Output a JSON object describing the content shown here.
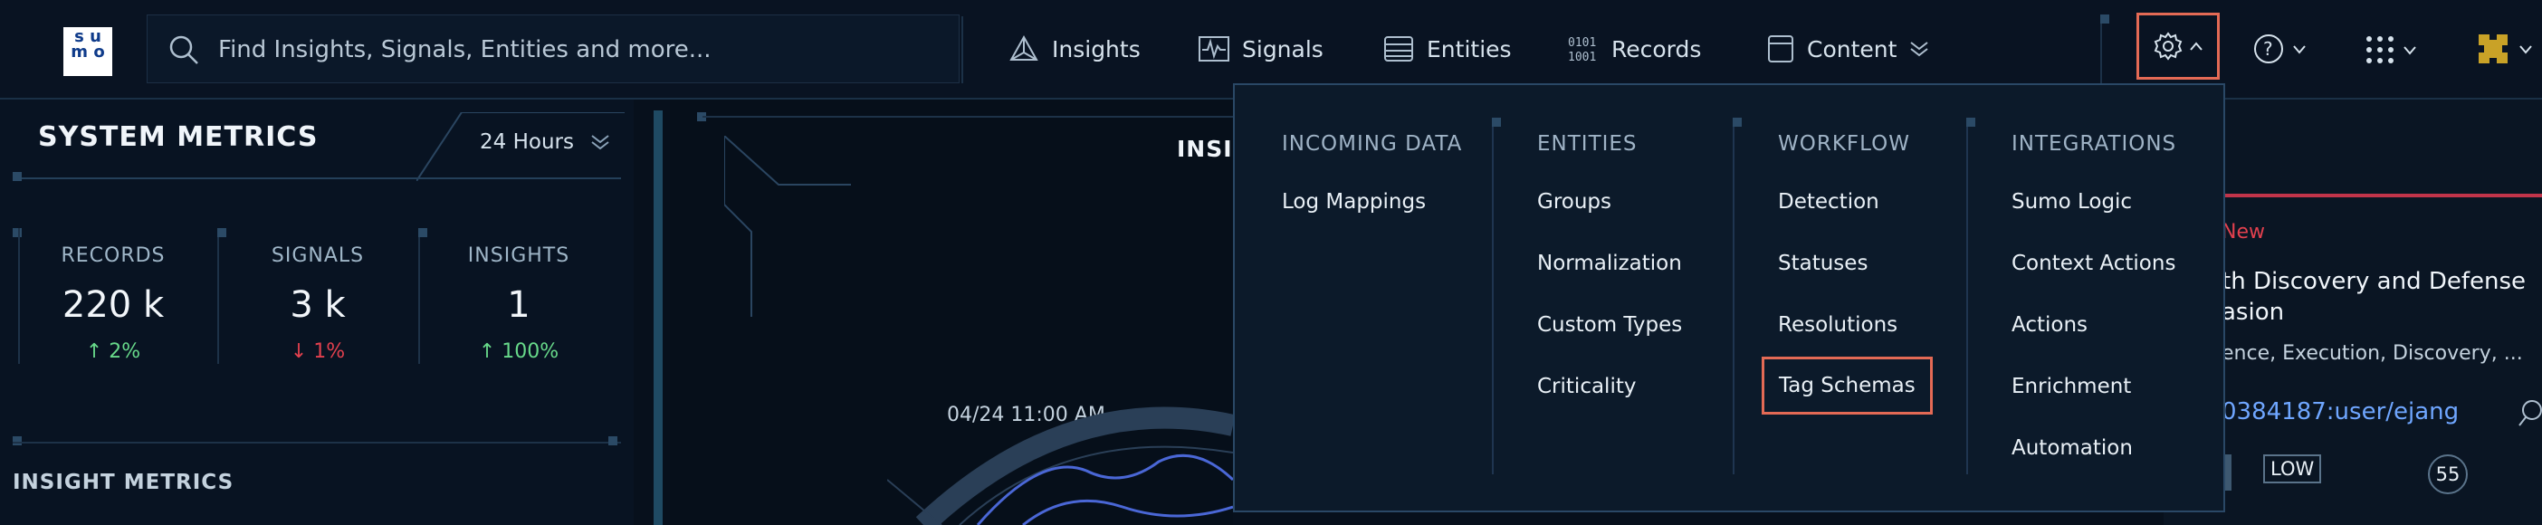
{
  "topbar": {
    "logo_text": "su mo",
    "search_placeholder": "Find Insights, Signals, Entities and more...",
    "nav": [
      {
        "label": "Insights",
        "icon": "insights-icon"
      },
      {
        "label": "Signals",
        "icon": "signals-icon"
      },
      {
        "label": "Entities",
        "icon": "entities-icon"
      },
      {
        "label": "Records",
        "icon": "records-icon"
      },
      {
        "label": "Content",
        "icon": "content-icon"
      }
    ]
  },
  "metrics": {
    "title": "SYSTEM METRICS",
    "range": "24 Hours",
    "items": [
      {
        "label": "RECORDS",
        "value": "220 k",
        "delta": "2%",
        "direction": "up"
      },
      {
        "label": "SIGNALS",
        "value": "3 k",
        "delta": "1%",
        "direction": "down"
      },
      {
        "label": "INSIGHTS",
        "value": "1",
        "delta": "100%",
        "direction": "up"
      }
    ],
    "insight_title": "INSIGHT METRICS"
  },
  "center": {
    "title_fragment": "INSIG",
    "timestamp": "04/24 11:00 AM"
  },
  "card": {
    "status": "New",
    "title_line1": "th Discovery and Defense",
    "title_line2": "asion",
    "tactics": "ence, Execution, Discovery, ...",
    "entity": "0384187:user/ejang",
    "severity": "LOW",
    "score": "55"
  },
  "settings_menu": {
    "columns": [
      {
        "heading": "INCOMING DATA",
        "items": [
          "Log Mappings"
        ]
      },
      {
        "heading": "ENTITIES",
        "items": [
          "Groups",
          "Normalization",
          "Custom Types",
          "Criticality"
        ]
      },
      {
        "heading": "WORKFLOW",
        "items": [
          "Detection",
          "Statuses",
          "Resolutions",
          "Tag Schemas"
        ]
      },
      {
        "heading": "INTEGRATIONS",
        "items": [
          "Sumo Logic",
          "Context Actions",
          "Actions",
          "Enrichment",
          "Automation"
        ]
      }
    ]
  },
  "colors": {
    "accent_up": "#67d98a",
    "accent_down": "#e2404e",
    "highlight": "#e46a55",
    "link": "#6fa6ff"
  }
}
